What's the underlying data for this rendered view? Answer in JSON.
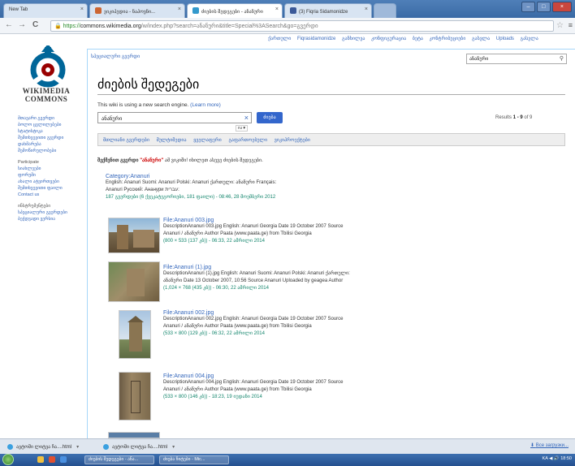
{
  "browser": {
    "tabs": [
      {
        "label": "New Tab",
        "fav": "#7fa2cc"
      },
      {
        "label": "ვიკიპედია - ნაპოვნი...",
        "fav": "#cc6633"
      },
      {
        "label": "ძიების შედეგები - ანანური",
        "fav": "#3399cc"
      },
      {
        "label": "(3) Fiqria Sidamonidze",
        "fav": "#3b5998"
      }
    ],
    "url_https": "https://",
    "url_host": "commons.wikimedia.org",
    "url_rest": "/w/index.php?search=ანანური&title=Special%3ASearch&go=გვერდი"
  },
  "personal": [
    "ქართული",
    "Fiqrasidamonidze",
    "განხილვა",
    "კონფიგურაცია",
    "ბეტა",
    "კონტრიბუციები",
    "გასვლა",
    "Uploads",
    "გასვლა"
  ],
  "logo_text": [
    "WIKIMEDIA",
    "COMMONS"
  ],
  "sidebar": {
    "links": [
      "მთავარი გვერდი",
      "ბოლო ცვლილებები",
      "სტატისტიკა",
      "შემთხვევითი გვერდი",
      "დახმარება",
      "შემოწირულობები"
    ],
    "participate_header": "Participate",
    "participate_links": [
      "სიახლეები",
      "ფორუმი",
      "ახალი ატვირთვები",
      "შემთხვევითი ფაილი",
      "Contact us"
    ],
    "tools_header": "ინსტრუმენტები",
    "tools_links": [
      "სპეციალური გვერდები",
      "ბეჭდვადი ვერსია"
    ]
  },
  "content": {
    "tab": "სპეციალური გვერდი",
    "search_value": "ანანური",
    "heading": "ძიების შედეგები",
    "notice": "This wiki is using a new search engine. ",
    "notice_link": "(Learn more)",
    "search_input": "ანანური",
    "search_button": "ძიება",
    "results_prefix": "Results ",
    "results_range": "1 - 9",
    "results_suffix": " of 9",
    "lang_select": "ru ▾",
    "profiles": [
      "მთლიანი გვერდები",
      "მულტიმედია",
      "ყველაფერი",
      "გაფართოებული",
      "ვიკიპროექტები"
    ],
    "suggest_prefix": "შექმენით გვერდი ",
    "suggest_query": "\"ანანური\"",
    "suggest_suffix": " ამ ვიკიში! იხილეთ ასევე ძიების შედეგები."
  },
  "results": [
    {
      "title": "Category:Ananuri",
      "lines": [
        "English: Ananuri Suomi: Ananuri Polski: Ananuri ქართული: ანანური Français:",
        "Ananuri Русский: Ананури עברית:"
      ],
      "meta": "187 გვერდები (6 ქვეკატეგორიები, 181 ფაილი) - 08:46, 28 მოემბერი 2012"
    },
    {
      "title": "File:Ananuri 003.jpg",
      "lines": [
        "DescriptionAnanuri 003.jpg English: Ananuri Georgia Date 19 October 2007 Source",
        "Ananuri / ანანური Author Paata (www.paata.ge) from Tbilisi Georgia"
      ],
      "meta": "(800 × 533 (137 კბ)) - 06:33, 22 ამრილი 2014"
    },
    {
      "title": "File:Ananuri (1).jpg",
      "lines": [
        "DescriptionAnanuri (1).jpg English: Ananuri Suomi: Ananuri Polski: Ananuri ქართული:",
        "ანანური Date 13 October 2007, 10:56 Source Ananuri Uploaded by geagea Author"
      ],
      "meta": "(1,024 × 768 (435 კბ)) - 06:30, 22 ამრილი 2014"
    },
    {
      "title": "File:Ananuri 002.jpg",
      "lines": [
        "DescriptionAnanuri 002.jpg English: Ananuri Georgia Date 19 October 2007 Source",
        "Ananuri / ანანური Author Paata (www.paata.ge) from Tbilisi Georgia"
      ],
      "meta": "(533 × 800 (129 კბ)) - 06:32, 22 ამრილი 2014"
    },
    {
      "title": "File:Ananuri 004.jpg",
      "lines": [
        "DescriptionAnanuri 004.jpg English: Ananuri Georgia Date 19 October 2007 Source",
        "Ananuri / ანანური Author Paata (www.paata.ge) from Tbilisi Georgia"
      ],
      "meta": "(533 × 800 (146 კბ)) - 18:23, 19 იუდანი 2014"
    }
  ],
  "downloads": [
    "ავტომი ლიტვა ჩა....html",
    "ავტომი ლიტვა ჩა....html"
  ],
  "download_all": "Все загрузки...",
  "taskbar": {
    "items": [
      "ძიების შედეგები - ანა...",
      "ძიება ჩიტები - Mic..."
    ],
    "tray": "KA  ◀ 🔊 18:50"
  }
}
